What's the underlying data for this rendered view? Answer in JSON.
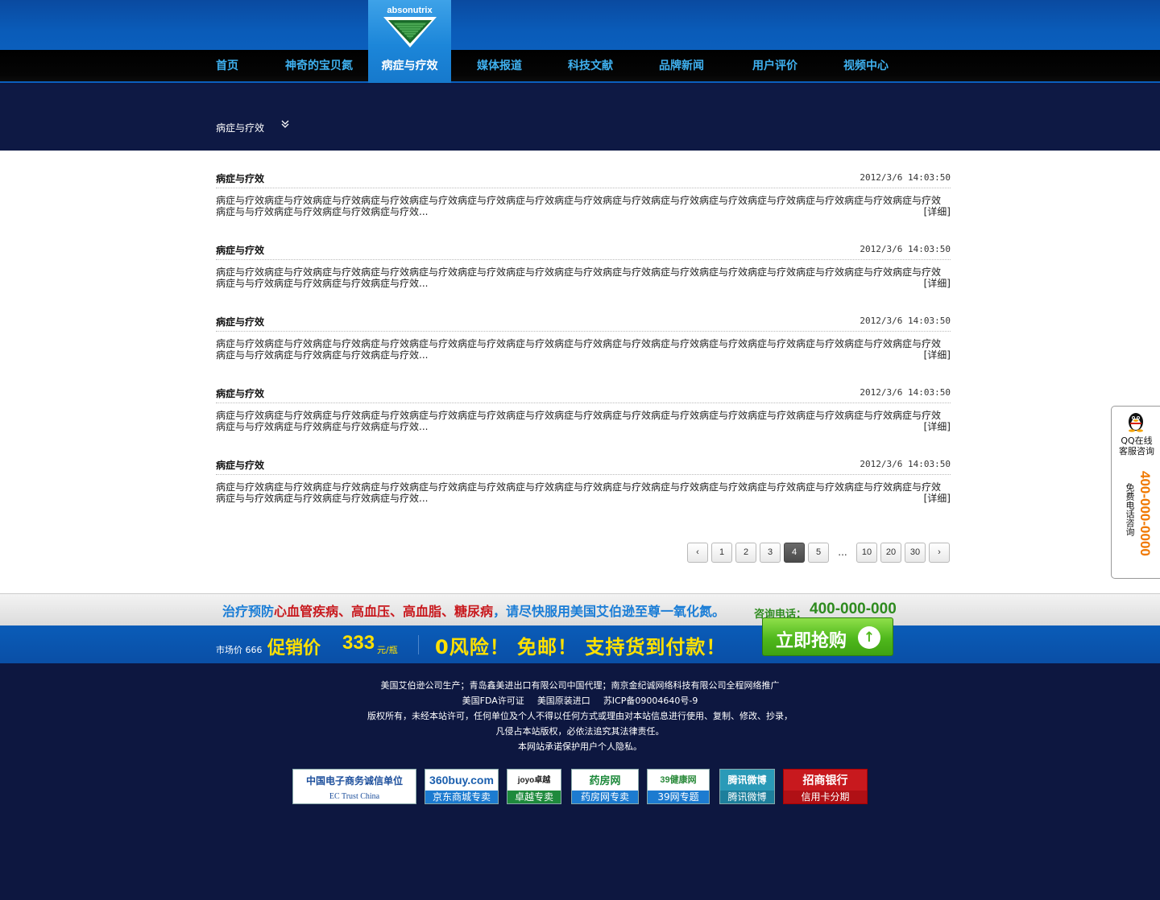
{
  "logo": {
    "text": "absonutrix"
  },
  "nav": {
    "items": [
      {
        "label": "首页"
      },
      {
        "label": "神奇的宝贝氮"
      },
      {
        "label": "病症与疗效"
      },
      {
        "label": "媒体报道"
      },
      {
        "label": "科技文献"
      },
      {
        "label": "品牌新闻"
      },
      {
        "label": "用户评价"
      },
      {
        "label": "视频中心"
      }
    ],
    "active_index": 2
  },
  "breadcrumb": {
    "label": "病症与疗效",
    "icon": "double-chevron-down-icon"
  },
  "articles": [
    {
      "title": "病症与疗效",
      "date": "2012/3/6 14:03:50",
      "line1": "病症与疗效病症与疗效病症与疗效病症与疗效病症与疗效病症与疗效病症与疗效病症与疗效病症与疗效病症与疗效病症与疗效病症与疗效病症与疗效病症与疗效病症与疗效",
      "line2": "病症与与疗效病症与疗效病症与疗效病症与疗效...",
      "more": "[详细]"
    },
    {
      "title": "病症与疗效",
      "date": "2012/3/6 14:03:50",
      "line1": "病症与疗效病症与疗效病症与疗效病症与疗效病症与疗效病症与疗效病症与疗效病症与疗效病症与疗效病症与疗效病症与疗效病症与疗效病症与疗效病症与疗效病症与疗效",
      "line2": "病症与与疗效病症与疗效病症与疗效病症与疗效...",
      "more": "[详细]"
    },
    {
      "title": "病症与疗效",
      "date": "2012/3/6 14:03:50",
      "line1": "病症与疗效病症与疗效病症与疗效病症与疗效病症与疗效病症与疗效病症与疗效病症与疗效病症与疗效病症与疗效病症与疗效病症与疗效病症与疗效病症与疗效病症与疗效",
      "line2": "病症与与疗效病症与疗效病症与疗效病症与疗效...",
      "more": "[详细]"
    },
    {
      "title": "病症与疗效",
      "date": "2012/3/6 14:03:50",
      "line1": "病症与疗效病症与疗效病症与疗效病症与疗效病症与疗效病症与疗效病症与疗效病症与疗效病症与疗效病症与疗效病症与疗效病症与疗效病症与疗效病症与疗效病症与疗效",
      "line2": "病症与与疗效病症与疗效病症与疗效病症与疗效...",
      "more": "[详细]"
    },
    {
      "title": "病症与疗效",
      "date": "2012/3/6 14:03:50",
      "line1": "病症与疗效病症与疗效病症与疗效病症与疗效病症与疗效病症与疗效病症与疗效病症与疗效病症与疗效病症与疗效病症与疗效病症与疗效病症与疗效病症与疗效病症与疗效",
      "line2": "病症与与疗效病症与疗效病症与疗效病症与疗效...",
      "more": "[详细]"
    }
  ],
  "pagination": {
    "prev": "‹",
    "next": "›",
    "pages": [
      "1",
      "2",
      "3",
      "4",
      "5"
    ],
    "current": "4",
    "ellipsis": "...",
    "tail_pages": [
      "10",
      "20",
      "30"
    ]
  },
  "promo": {
    "text_a": "治疗预防",
    "text_b": "心血管疾病、高血压、高血脂、糖尿病",
    "text_c": "，请尽快服用美国艾伯逊至尊一氧化氮。",
    "hotline_label": "咨询电话：",
    "hotline": "400-000-000",
    "market_price": "市场价 666",
    "sale_label": "促销价",
    "sale_price": "333",
    "sale_unit": "元/瓶",
    "slogan": "0风险！ 免邮！ 支持货到付款！",
    "buy_label": "立即抢购",
    "accent_green": "#4fb81c",
    "accent_yellow": "#ffe000"
  },
  "footer": {
    "line1": "美国艾伯逊公司生产；青岛鑫美进出口有限公司中国代理；南京金纪诚网络科技有限公司全程网络推广",
    "line2_a": "美国FDA许可证",
    "line2_b": "美国原装进口",
    "line2_c": "苏ICP备09004640号-9",
    "line3": "版权所有，未经本站许可，任何单位及个人不得以任何方式或理由对本站信息进行使用、复制、修改、抄录，",
    "line4": "凡侵占本站版权，必依法追究其法律责任。",
    "line5": "本网站承诺保护用户个人隐私。",
    "badges": [
      {
        "top": "中国电子商务诚信单位",
        "bottom": "EC Trust China"
      },
      {
        "top": "360buy.com",
        "bottom": "京东商城专卖"
      },
      {
        "top": "joyo卓越 amazon.cn",
        "bottom": "卓越专卖"
      },
      {
        "top": "药房网",
        "bottom": "药房网专卖"
      },
      {
        "top": "39健康网",
        "bottom": "39网专题"
      },
      {
        "top": "腾讯微博",
        "bottom": "腾讯微博"
      },
      {
        "top": "招商银行",
        "bottom": "信用卡分期"
      }
    ]
  },
  "side_float": {
    "qq_label_1": "QQ在线",
    "qq_label_2": "客服咨询",
    "free_call": "免费电话咨询",
    "phone": "400-000-0000"
  },
  "colors": {
    "header_blue": "#0a5bb8",
    "nav_text": "#3fb1f0",
    "banner_navy": "#0e1944",
    "phone_orange": "#f07800"
  }
}
